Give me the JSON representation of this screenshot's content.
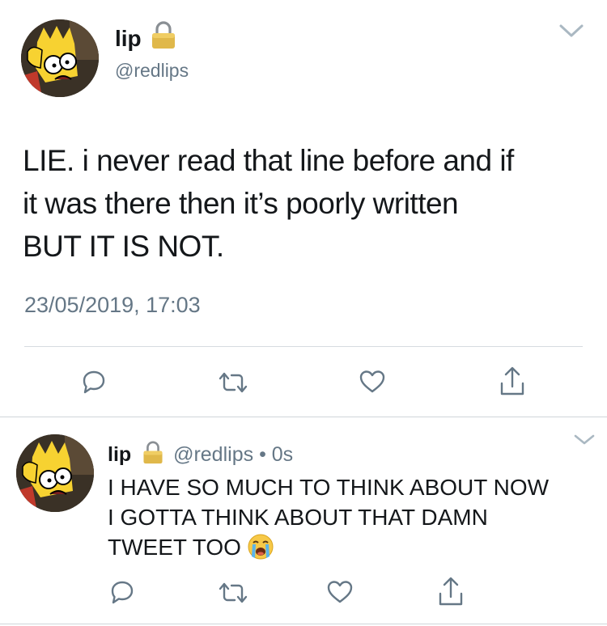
{
  "main_tweet": {
    "author_name": "lip",
    "author_handle": "@redlips",
    "text_line_1": "LIE. i never read that line before and if",
    "text_line_2": "it was there then it’s poorly written",
    "text_line_3": "BUT IT IS NOT.",
    "timestamp": "23/05/2019, 17:03",
    "locked": true
  },
  "reply_tweet": {
    "author_name": "lip",
    "author_handle": "@redlips",
    "separator": "•",
    "age": "0s",
    "text_line_1": "I HAVE SO MUCH TO THINK ABOUT NOW",
    "text_line_2": "I GOTTA THINK ABOUT THAT DAMN",
    "text_line_3": "TWEET TOO",
    "emoji": "loudly-crying-face",
    "locked": true
  },
  "icons": {
    "reply": "reply-icon",
    "retweet": "retweet-icon",
    "like": "heart-icon",
    "share": "share-icon",
    "more": "chevron-down-icon",
    "lock": "lock-icon"
  },
  "colors": {
    "text": "#14171a",
    "secondary": "#657786",
    "divider": "#d6dbe0",
    "lock_gold": "#e0b84a"
  }
}
